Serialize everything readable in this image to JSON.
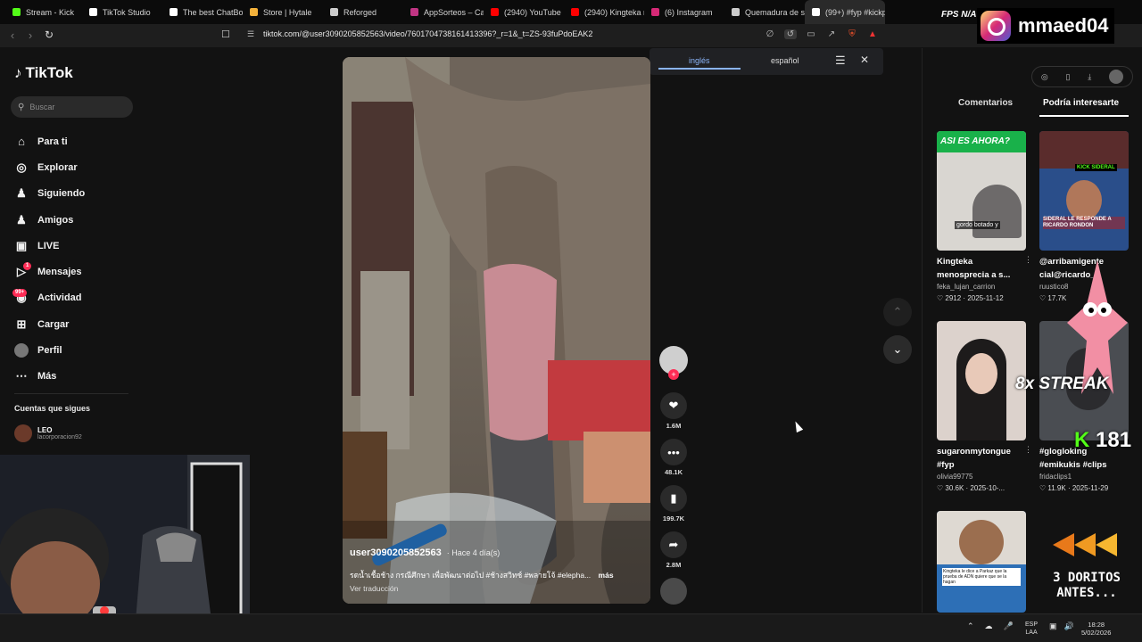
{
  "browser": {
    "tabs": [
      {
        "title": "Stream - Kick",
        "color": "#53fc18"
      },
      {
        "title": "TikTok Studio",
        "color": "#ffffff"
      },
      {
        "title": "The best ChatBot",
        "color": "#ffffff"
      },
      {
        "title": "Store | Hytale",
        "color": "#f3b13b"
      },
      {
        "title": "Reforged",
        "color": "#cccccc"
      },
      {
        "title": "AppSorteos – Ca",
        "color": "#c13584"
      },
      {
        "title": "(2940) YouTube",
        "color": "#ff0000"
      },
      {
        "title": "(2940) Kingteka m",
        "color": "#ff0000"
      },
      {
        "title": "(6) Instagram",
        "color": "#d62976"
      },
      {
        "title": "Quemadura de so",
        "color": "#cccccc"
      },
      {
        "title": "(99+) #fyp #kickp",
        "color": "#ffffff"
      }
    ],
    "url": "tiktok.com/@user3090205852563/video/7601704738161413396?_r=1&_t=ZS-93fuPdoEAK2"
  },
  "translate": {
    "lang_from": "inglés",
    "lang_to": "español"
  },
  "sidebar": {
    "logo": "TikTok",
    "search_placeholder": "Buscar",
    "items": [
      {
        "label": "Para ti",
        "icon": "home-icon"
      },
      {
        "label": "Explorar",
        "icon": "compass-icon"
      },
      {
        "label": "Siguiendo",
        "icon": "following-icon"
      },
      {
        "label": "Amigos",
        "icon": "friends-icon"
      },
      {
        "label": "LIVE",
        "icon": "live-icon"
      },
      {
        "label": "Mensajes",
        "icon": "messages-icon",
        "badge": "1"
      },
      {
        "label": "Actividad",
        "icon": "activity-icon",
        "badge": "99+"
      },
      {
        "label": "Cargar",
        "icon": "upload-icon"
      },
      {
        "label": "Perfil",
        "icon": "profile-icon"
      },
      {
        "label": "Más",
        "icon": "more-icon"
      }
    ],
    "following_title": "Cuentas que sigues",
    "following": [
      {
        "name": "LEO",
        "handle": "lacorporacion92"
      }
    ]
  },
  "video": {
    "username": "user3090205852563",
    "time_ago": "· Hace 4 día(s)",
    "caption": "รดน้ำเชื้อช้าง กรณีศึกษา เพื่อพัฒนาต่อไป #ช้างสวิทซ์ #พลายโจ้ #elepha...",
    "more": "más",
    "translate_link": "Ver traducción"
  },
  "actions": {
    "likes": "1.6M",
    "comments": "48.1K",
    "saves": "199.7K",
    "shares": "2.8M"
  },
  "right_panel": {
    "tab_comments": "Comentarios",
    "tab_suggested": "Podría interesarte",
    "cards": [
      {
        "title": "Kingteka menosprecia a s...",
        "author": "feka_lujan_carrion",
        "likes": "2912",
        "date": "2025-11-12",
        "thumb_text": "ASI ES AHORA?",
        "thumb_sub": "gordo botado y"
      },
      {
        "title": "@arribamigente cial@ricardo_r",
        "author": "ruustico8",
        "likes": "17.7K",
        "date": "",
        "thumb_text": "KICK SIDERAL",
        "thumb_sub": "SIDERAL LE RESPONDE A RICARDO RONDON"
      },
      {
        "title": "sugaronmytongue #fyp",
        "author": "olivia99775",
        "likes": "30.6K",
        "date": "2025-10-...",
        "thumb_text": "",
        "thumb_sub": ""
      },
      {
        "title": "#glogloking #emikukis #clips",
        "author": "fridaclips1",
        "likes": "11.9K",
        "date": "2025-11-29",
        "thumb_text": "",
        "thumb_sub": ""
      },
      {
        "title": "",
        "author": "",
        "likes": "",
        "date": "",
        "thumb_text": "",
        "thumb_sub": "Kingteka le dice a Parkaz que la prueba de ADN quiere que se la hagan"
      }
    ]
  },
  "overlays": {
    "instagram_handle": "mmaed04",
    "streak": "8x STREAK",
    "kick_count": "181",
    "doritos": "3 DORITOS ANTES...",
    "fps": "FPS N/A"
  },
  "taskbar": {
    "lang": "ESP",
    "layout": "LAA",
    "time": "18:28",
    "date": "5/02/2026"
  }
}
